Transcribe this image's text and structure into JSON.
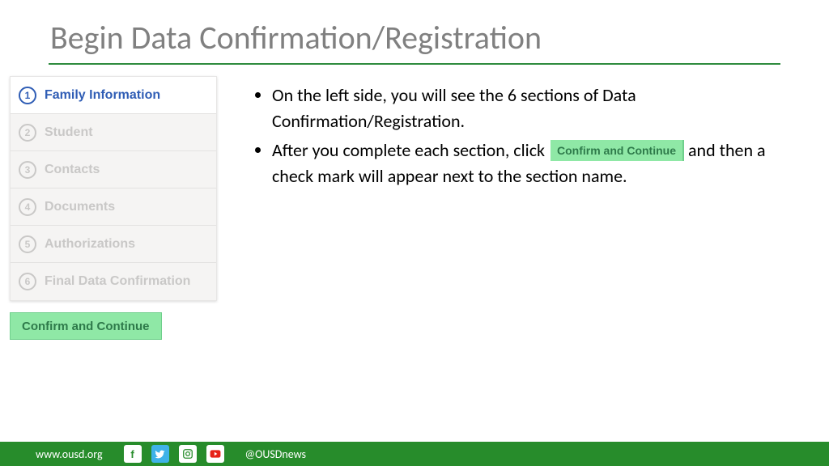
{
  "title": "Begin Data Confirmation/Registration",
  "sidebar": {
    "items": [
      {
        "num": "1",
        "label": "Family Information",
        "active": true
      },
      {
        "num": "2",
        "label": "Student",
        "active": false
      },
      {
        "num": "3",
        "label": "Contacts",
        "active": false
      },
      {
        "num": "4",
        "label": "Documents",
        "active": false
      },
      {
        "num": "5",
        "label": "Authorizations",
        "active": false
      },
      {
        "num": "6",
        "label": "Final Data Confirmation",
        "active": false
      }
    ]
  },
  "confirm_button": "Confirm and Continue",
  "bullets": {
    "b1": "On the left side, you will see the 6 sections of Data Confirmation/Registration.",
    "b2_pre": "After you complete each section, click",
    "b2_chip": "Confirm and Continue",
    "b2_post": "and then a check mark will appear next to the section name."
  },
  "footer": {
    "url": "www.ousd.org",
    "handle": "@OUSDnews"
  }
}
